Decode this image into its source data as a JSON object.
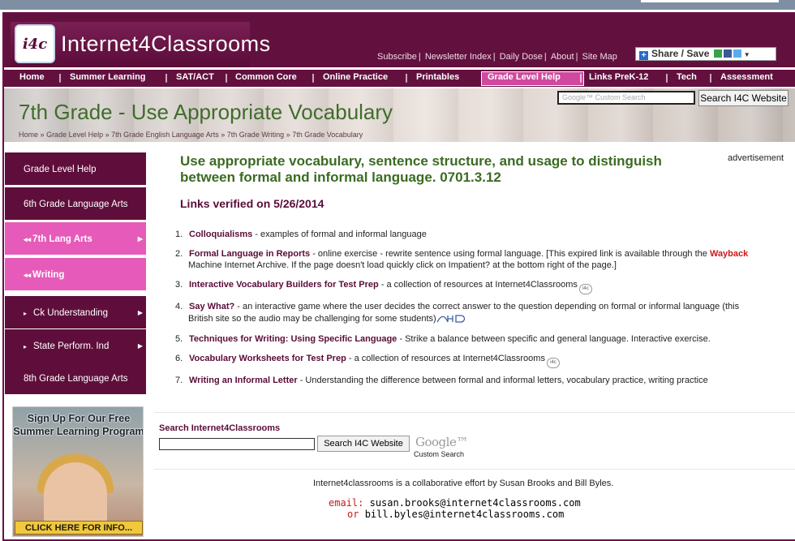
{
  "site": {
    "logo_badge": "i4c",
    "logo_text": "Internet4Classrooms",
    "top_links": [
      "Subscribe",
      "Newsletter Index",
      "Daily Dose",
      "About",
      "Site Map"
    ],
    "share_label": "Share / Save"
  },
  "nav": {
    "items": [
      "Home",
      "Summer Learning",
      "SAT/ACT",
      "Common Core",
      "Online Practice",
      "Printables",
      "Grade Level Help",
      "Links PreK-12",
      "Tech",
      "Assessment"
    ],
    "active": "Grade Level Help"
  },
  "banner": {
    "title": "7th Grade - Use Appropriate Vocabulary",
    "breadcrumb": [
      "Home",
      "Grade Level Help",
      "7th Grade English Language Arts",
      "7th Grade Writing",
      "7th Grade Vocabulary"
    ],
    "breadcrumb_sep": "»",
    "search_placeholder": "Google™ Custom Search",
    "search_button": "Search I4C Website"
  },
  "sidebar": {
    "items": [
      {
        "label": "Grade Level Help",
        "style": "dark"
      },
      {
        "label": "6th Grade Language Arts",
        "style": "dark"
      },
      {
        "label": "7th Lang Arts",
        "style": "pink"
      },
      {
        "label": "Writing",
        "style": "pink"
      },
      {
        "label": "Ck Understanding",
        "style": "dark"
      },
      {
        "label": "State Perform. Ind",
        "style": "dark"
      },
      {
        "label": "8th Grade Language Arts",
        "style": "dark"
      }
    ],
    "promo_text": "Sign Up For Our Free Summer Learning Program",
    "promo_cta": "CLICK HERE FOR INFO..."
  },
  "main": {
    "title": "Use appropriate vocabulary, sentence structure, and usage to distinguish between formal and informal language. 0701.3.12",
    "ad_label": "advertisement",
    "verified": "Links verified on 5/26/2014",
    "links": [
      {
        "num": "1.",
        "title": "Colloquialisms",
        "desc": " - examples of formal and informal language"
      },
      {
        "num": "2.",
        "title": "Formal Language in Reports",
        "desc": " - online exercise - rewrite sentence using formal language. [This expired link is available through the ",
        "wayback": "Wayback",
        "line2_a": "Machine",
        "line2_b": " Internet Archive. If the page doesn't load quickly click on ",
        "impatient": "Impatient?",
        "line2_c": " at the bottom right of the page.]"
      },
      {
        "num": "3.",
        "title": "Interactive Vocabulary Builders for Test Prep",
        "desc": " - a collection of resources at Internet4Classrooms"
      },
      {
        "num": "4.",
        "title": "Say What?",
        "desc": " - an interactive game where the user decides the correct answer to the question depending on formal or informal language (this",
        "line2": "British site so the audio may be challenging for some students)"
      },
      {
        "num": "5.",
        "title": "Techniques for Writing: Using Specific Language",
        "desc": " - Strike a balance between specific and general language. Interactive exercise."
      },
      {
        "num": "6.",
        "title": "Vocabulary Worksheets for Test Prep",
        "desc": " - a collection of resources at Internet4Classrooms"
      },
      {
        "num": "7.",
        "title": "Writing an Informal Letter",
        "desc": " - Understanding the difference between formal and informal letters, vocabulary practice, writing practice"
      }
    ]
  },
  "bottom_search": {
    "label": "Search Internet4Classrooms",
    "button": "Search I4C Website",
    "google": "Google™",
    "google_sub": "Custom Search"
  },
  "footer": {
    "text": "Internet4classrooms is a collaborative effort by Susan Brooks and Bill Byles.",
    "email_label": "email:",
    "email1": "susan.brooks@internet4classrooms.com",
    "or_label": "or",
    "email2": "bill.byles@internet4classrooms.com"
  },
  "colors": {
    "brand": "#62113f",
    "accent_pink": "#e65bb9",
    "title_green": "#3b6b22",
    "link_maroon": "#5a0c38"
  }
}
